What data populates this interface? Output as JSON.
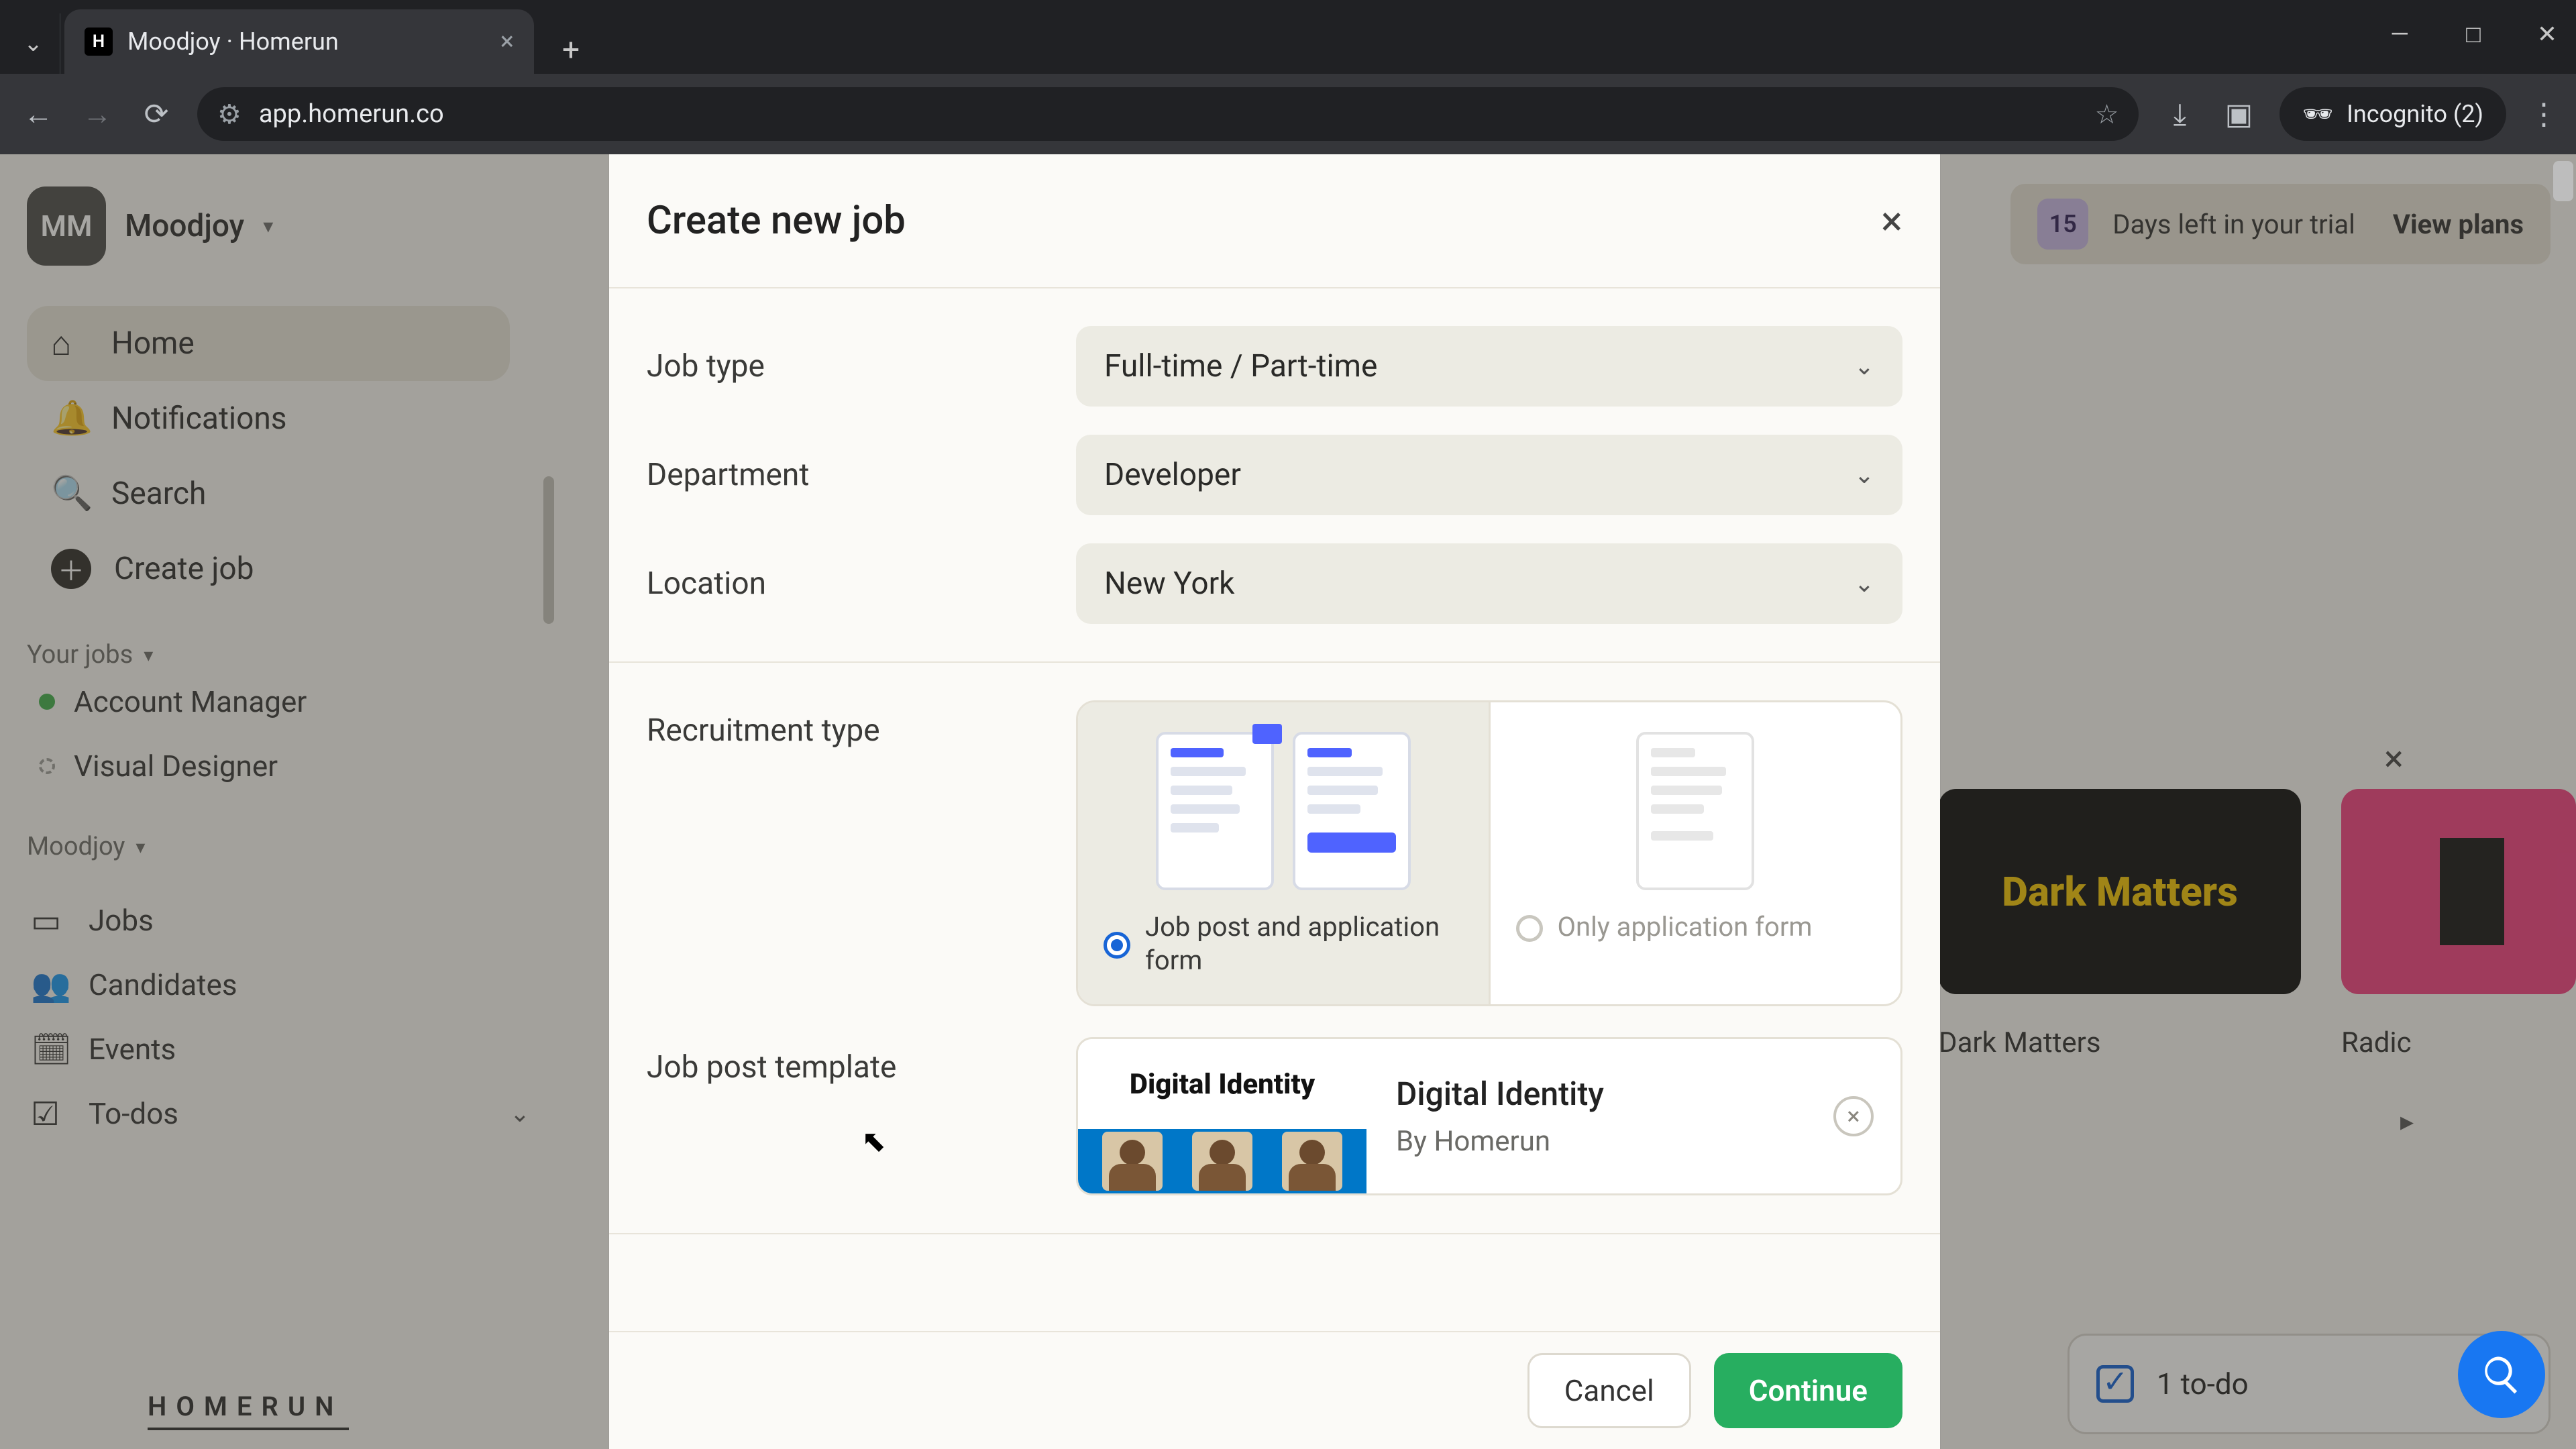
{
  "browser": {
    "tab_title": "Moodjoy · Homerun",
    "favicon_text": "H",
    "url": "app.homerun.co",
    "incognito_label": "Incognito (2)"
  },
  "sidebar": {
    "workspace_initials": "MM",
    "workspace_name": "Moodjoy",
    "nav": {
      "home": "Home",
      "notifications": "Notifications",
      "search": "Search",
      "create_job": "Create job"
    },
    "section_your_jobs": "Your jobs",
    "jobs": [
      {
        "label": "Account Manager"
      },
      {
        "label": "Visual Designer"
      }
    ],
    "section_company": "Moodjoy",
    "bottom": {
      "jobs": "Jobs",
      "candidates": "Candidates",
      "events": "Events",
      "todos": "To-dos"
    },
    "logo_text": "HOMERUN"
  },
  "trial": {
    "days": "15",
    "text": "Days left in your trial",
    "cta": "View plans"
  },
  "background": {
    "dark_matters_title": "Dark\nMatters",
    "dark_matters_label": "Dark Matters",
    "radic_label": "Radic",
    "todo_text": "1 to-do"
  },
  "modal": {
    "title": "Create new job",
    "labels": {
      "job_type": "Job type",
      "department": "Department",
      "location": "Location",
      "recruitment_type": "Recruitment type",
      "job_post_template": "Job post template"
    },
    "values": {
      "job_type": "Full-time / Part-time",
      "department": "Developer",
      "location": "New York"
    },
    "recruitment_options": {
      "both": "Job post and application form",
      "only": "Only application form"
    },
    "template": {
      "thumb_title": "Digital Identity",
      "name": "Digital Identity",
      "byline": "By Homerun"
    },
    "buttons": {
      "cancel": "Cancel",
      "continue": "Continue"
    }
  }
}
